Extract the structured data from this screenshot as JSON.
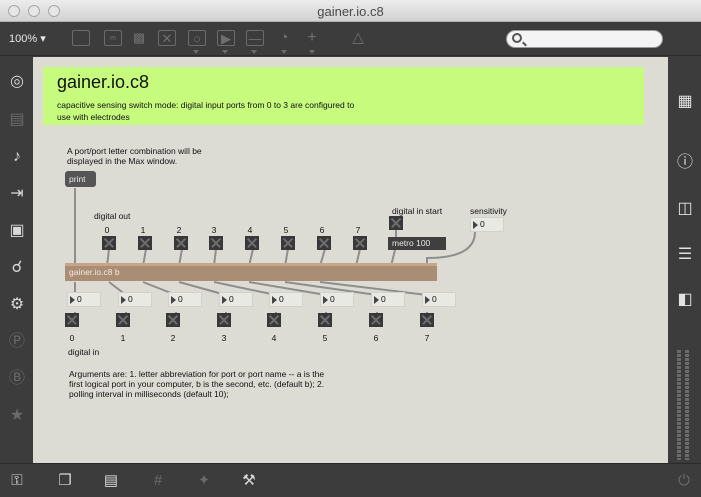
{
  "window": {
    "title": "gainer.io.c8"
  },
  "toolbar": {
    "zoom_label": "100%",
    "search_placeholder": ""
  },
  "patch": {
    "title": "gainer.io.c8",
    "description": "capacitive sensing switch mode: digital input ports from 0 to 3 are configured to use with electrodes",
    "print_comment": "A port/port letter combination will be displayed in the Max window.",
    "print_label": "print",
    "digital_out_label": "digital out",
    "digital_out_ports": [
      "0",
      "1",
      "2",
      "3",
      "4",
      "5",
      "6",
      "7"
    ],
    "digital_in_start_label": "digital in start",
    "metro_label": "metro 100",
    "sensitivity_label": "sensitivity",
    "sensitivity_value": "0",
    "object_label": "gainer.io.c8 b",
    "number_values": [
      "0",
      "0",
      "0",
      "0",
      "0",
      "0",
      "0",
      "0"
    ],
    "digital_in_ports": [
      "0",
      "1",
      "2",
      "3",
      "4",
      "5",
      "6",
      "7"
    ],
    "digital_in_label": "digital in",
    "arguments_text": "Arguments are: 1. letter abbreviation for port or port name -- a is the first logical port in your computer, b is the second, etc. (default b); 2. polling interval in milliseconds (default 10);"
  },
  "sidebar_left_icons": [
    "target-icon",
    "keyboard-icon",
    "music-note-icon",
    "bracket-arrow-icon",
    "image-icon",
    "paperclip-icon",
    "plug-icon",
    "v-circle-icon",
    "b-circle-icon",
    "star-icon"
  ],
  "sidebar_right_icons": [
    "grid-icon",
    "info-icon",
    "book-icon",
    "list-icon",
    "open-book-icon"
  ],
  "bottom_icons": [
    "lock-icon",
    "windows-icon",
    "presentation-icon",
    "grid-icon",
    "sparkle-icon",
    "wrench-icon",
    "power-icon"
  ]
}
